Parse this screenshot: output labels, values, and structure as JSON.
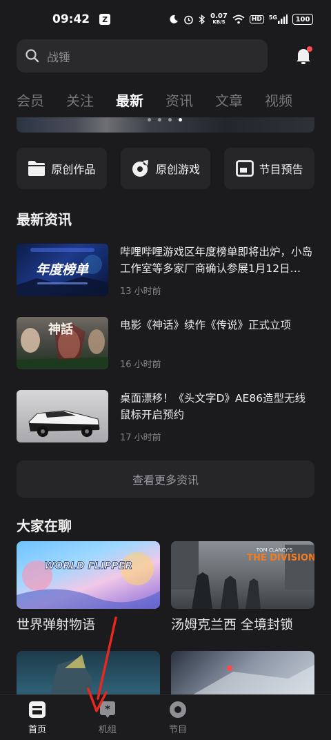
{
  "status_bar": {
    "time": "09:42",
    "net_speed": "0.07",
    "net_unit": "KB/S",
    "hd": "HD",
    "signal": "5G",
    "battery": "100"
  },
  "search": {
    "placeholder": "战锤"
  },
  "tabs": [
    {
      "label": "会员",
      "active": false
    },
    {
      "label": "关注",
      "active": false
    },
    {
      "label": "最新",
      "active": true
    },
    {
      "label": "资讯",
      "active": false
    },
    {
      "label": "文章",
      "active": false
    },
    {
      "label": "视频",
      "active": false
    }
  ],
  "banner": {
    "dot_count": 4,
    "active_dot_index": 3
  },
  "shortcuts": [
    {
      "label": "原创作品",
      "icon": "folder-icon"
    },
    {
      "label": "原创游戏",
      "icon": "game-disc-icon"
    },
    {
      "label": "节目预告",
      "icon": "preview-window-icon"
    }
  ],
  "latest_news": {
    "title": "最新资讯",
    "items": [
      {
        "title": "哔哩哔哩游戏区年度榜单即将出炉，小岛工作室等多家厂商确认参展1月12日…",
        "time": "13 小时前",
        "thumb_text": "年度榜单"
      },
      {
        "title": "电影《神话》续作《传说》正式立项",
        "time": "16 小时前",
        "thumb_text": "神話"
      },
      {
        "title": "桌面漂移！《头文字D》AE86造型无线鼠标开启预约",
        "time": "17 小时前",
        "thumb_text": ""
      }
    ],
    "more_label": "查看更多资讯"
  },
  "discussions": {
    "title": "大家在聊",
    "items": [
      {
        "name": "世界弹射物语",
        "thumb_text": "WORLD FLIPPER"
      },
      {
        "name": "汤姆克兰西 全境封锁",
        "thumb_text": "THE DIVISION",
        "thumb_subtext": "TOM CLANCY'S"
      },
      {
        "name": "",
        "thumb_text": ""
      },
      {
        "name": "",
        "thumb_text": ""
      }
    ]
  },
  "bottom_nav": [
    {
      "label": "首页",
      "icon": "home-icon",
      "active": true
    },
    {
      "label": "机组",
      "icon": "crew-icon",
      "active": false
    },
    {
      "label": "节目",
      "icon": "program-icon",
      "active": false
    }
  ],
  "colors": {
    "background": "#1b1b1d",
    "card": "#262629",
    "notification_dot": "#ff4d4f",
    "annotation_arrow": "#e8281f"
  }
}
